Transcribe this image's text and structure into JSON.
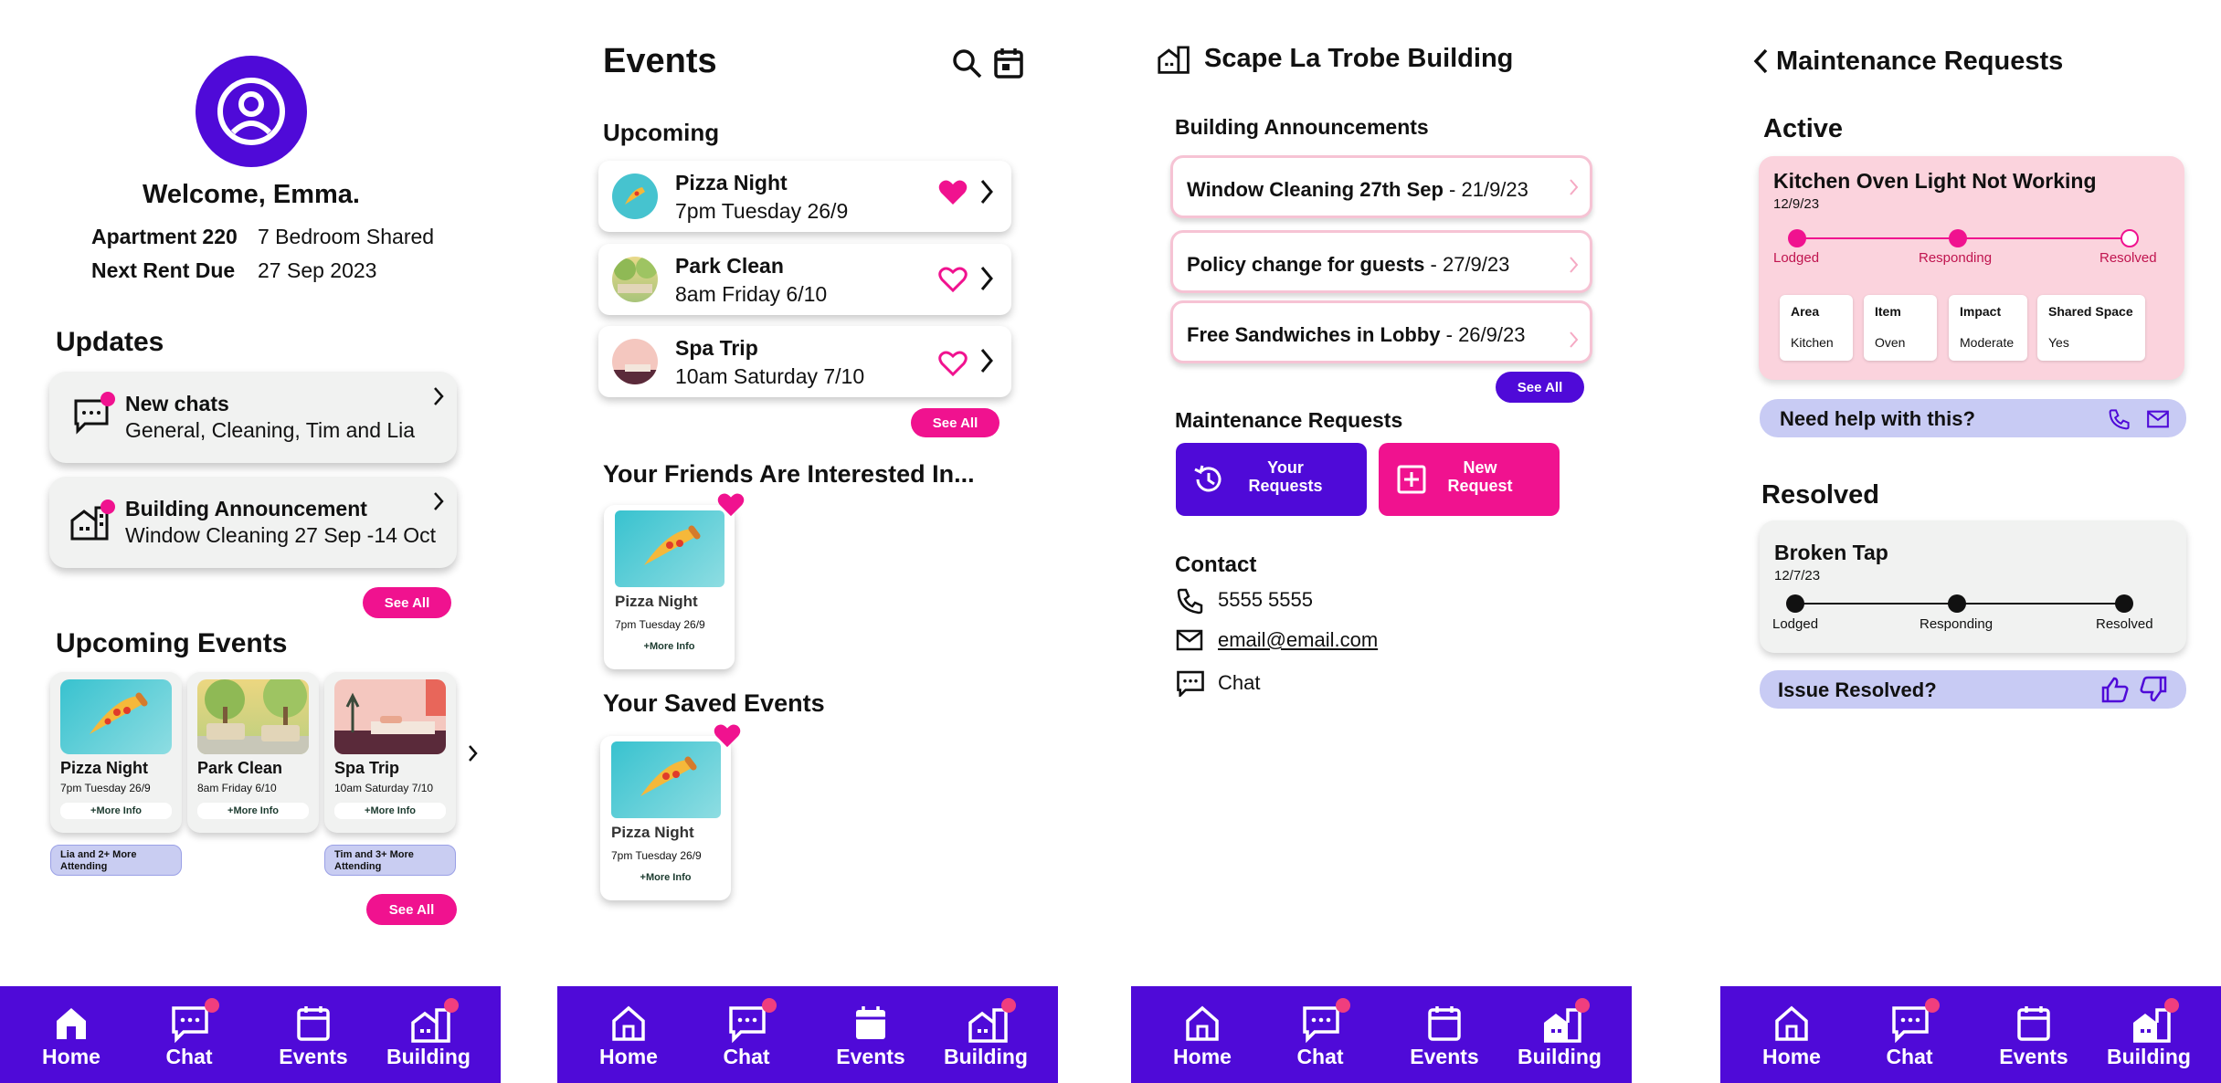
{
  "colors": {
    "purple": "#4f0ad8",
    "pink": "#f0128f",
    "light_pink": "#fbd3dd",
    "lavender": "#c8cbf4",
    "card_gray": "#f1f2f1"
  },
  "nav": {
    "home": "Home",
    "chat": "Chat",
    "events": "Events",
    "building": "Building"
  },
  "screen1": {
    "welcome": "Welcome, Emma.",
    "info": [
      {
        "label": "Apartment 220",
        "value": "7 Bedroom Shared"
      },
      {
        "label": "Next Rent Due",
        "value": "27 Sep 2023"
      }
    ],
    "updates_title": "Updates",
    "updates": [
      {
        "title": "New chats",
        "subtitle": "General, Cleaning, Tim and Lia",
        "icon": "chat-icon"
      },
      {
        "title": "Building Announcement",
        "subtitle": "Window Cleaning 27 Sep -14 Oct",
        "icon": "building-icon"
      }
    ],
    "see_all": "See All",
    "upcoming_title": "Upcoming Events",
    "events": [
      {
        "title": "Pizza Night",
        "time": "7pm Tuesday 26/9",
        "more": "+More Info",
        "attending": "Lia and 2+ More Attending"
      },
      {
        "title": "Park Clean",
        "time": "8am Friday 6/10",
        "more": "+More Info",
        "attending": ""
      },
      {
        "title": "Spa Trip",
        "time": "10am Saturday 7/10",
        "more": "+More Info",
        "attending": "Tim and 3+ More Attending"
      }
    ],
    "see_all_events": "See All"
  },
  "screen2": {
    "title": "Events",
    "upcoming_title": "Upcoming",
    "upcoming": [
      {
        "title": "Pizza Night",
        "time": "7pm Tuesday 26/9",
        "liked": true
      },
      {
        "title": "Park Clean",
        "time": "8am Friday 6/10",
        "liked": false
      },
      {
        "title": "Spa Trip",
        "time": "10am Saturday 7/10",
        "liked": false
      }
    ],
    "see_all": "See All",
    "friends_title": "Your Friends Are Interested In...",
    "friends_event": {
      "title": "Pizza Night",
      "time": "7pm Tuesday 26/9",
      "more": "+More Info"
    },
    "saved_title": "Your Saved Events",
    "saved_event": {
      "title": "Pizza Night",
      "time": "7pm Tuesday 26/9",
      "more": "+More Info"
    }
  },
  "screen3": {
    "title": "Scape La Trobe Building",
    "announcements_title": "Building Announcements",
    "announcements": [
      {
        "title": "Window Cleaning 27th Sep",
        "date": " - 21/9/23"
      },
      {
        "title": "Policy change for guests",
        "date": " - 27/9/23"
      },
      {
        "title": "Free Sandwiches in Lobby",
        "date": " - 26/9/23"
      }
    ],
    "see_all": "See All",
    "maintenance_title": "Maintenance Requests",
    "your_requests": "Your Requests",
    "new_request": "New Request",
    "contact_title": "Contact",
    "phone": "5555 5555",
    "email": "email@email.com",
    "chat": "Chat"
  },
  "screen4": {
    "title": "Maintenance Requests",
    "active_title": "Active",
    "active": {
      "title": "Kitchen Oven Light Not Working",
      "date": "12/9/23",
      "steps": [
        "Lodged",
        "Responding",
        "Resolved"
      ],
      "progress_step": 2,
      "details": [
        {
          "label": "Area",
          "value": "Kitchen"
        },
        {
          "label": "Item",
          "value": "Oven"
        },
        {
          "label": "Impact",
          "value": "Moderate"
        },
        {
          "label": "Shared Space",
          "value": "Yes"
        }
      ]
    },
    "help": "Need help with this?",
    "resolved_title": "Resolved",
    "resolved": {
      "title": "Broken Tap",
      "date": "12/7/23",
      "steps": [
        "Lodged",
        "Responding",
        "Resolved"
      ]
    },
    "issue": "Issue Resolved?"
  }
}
